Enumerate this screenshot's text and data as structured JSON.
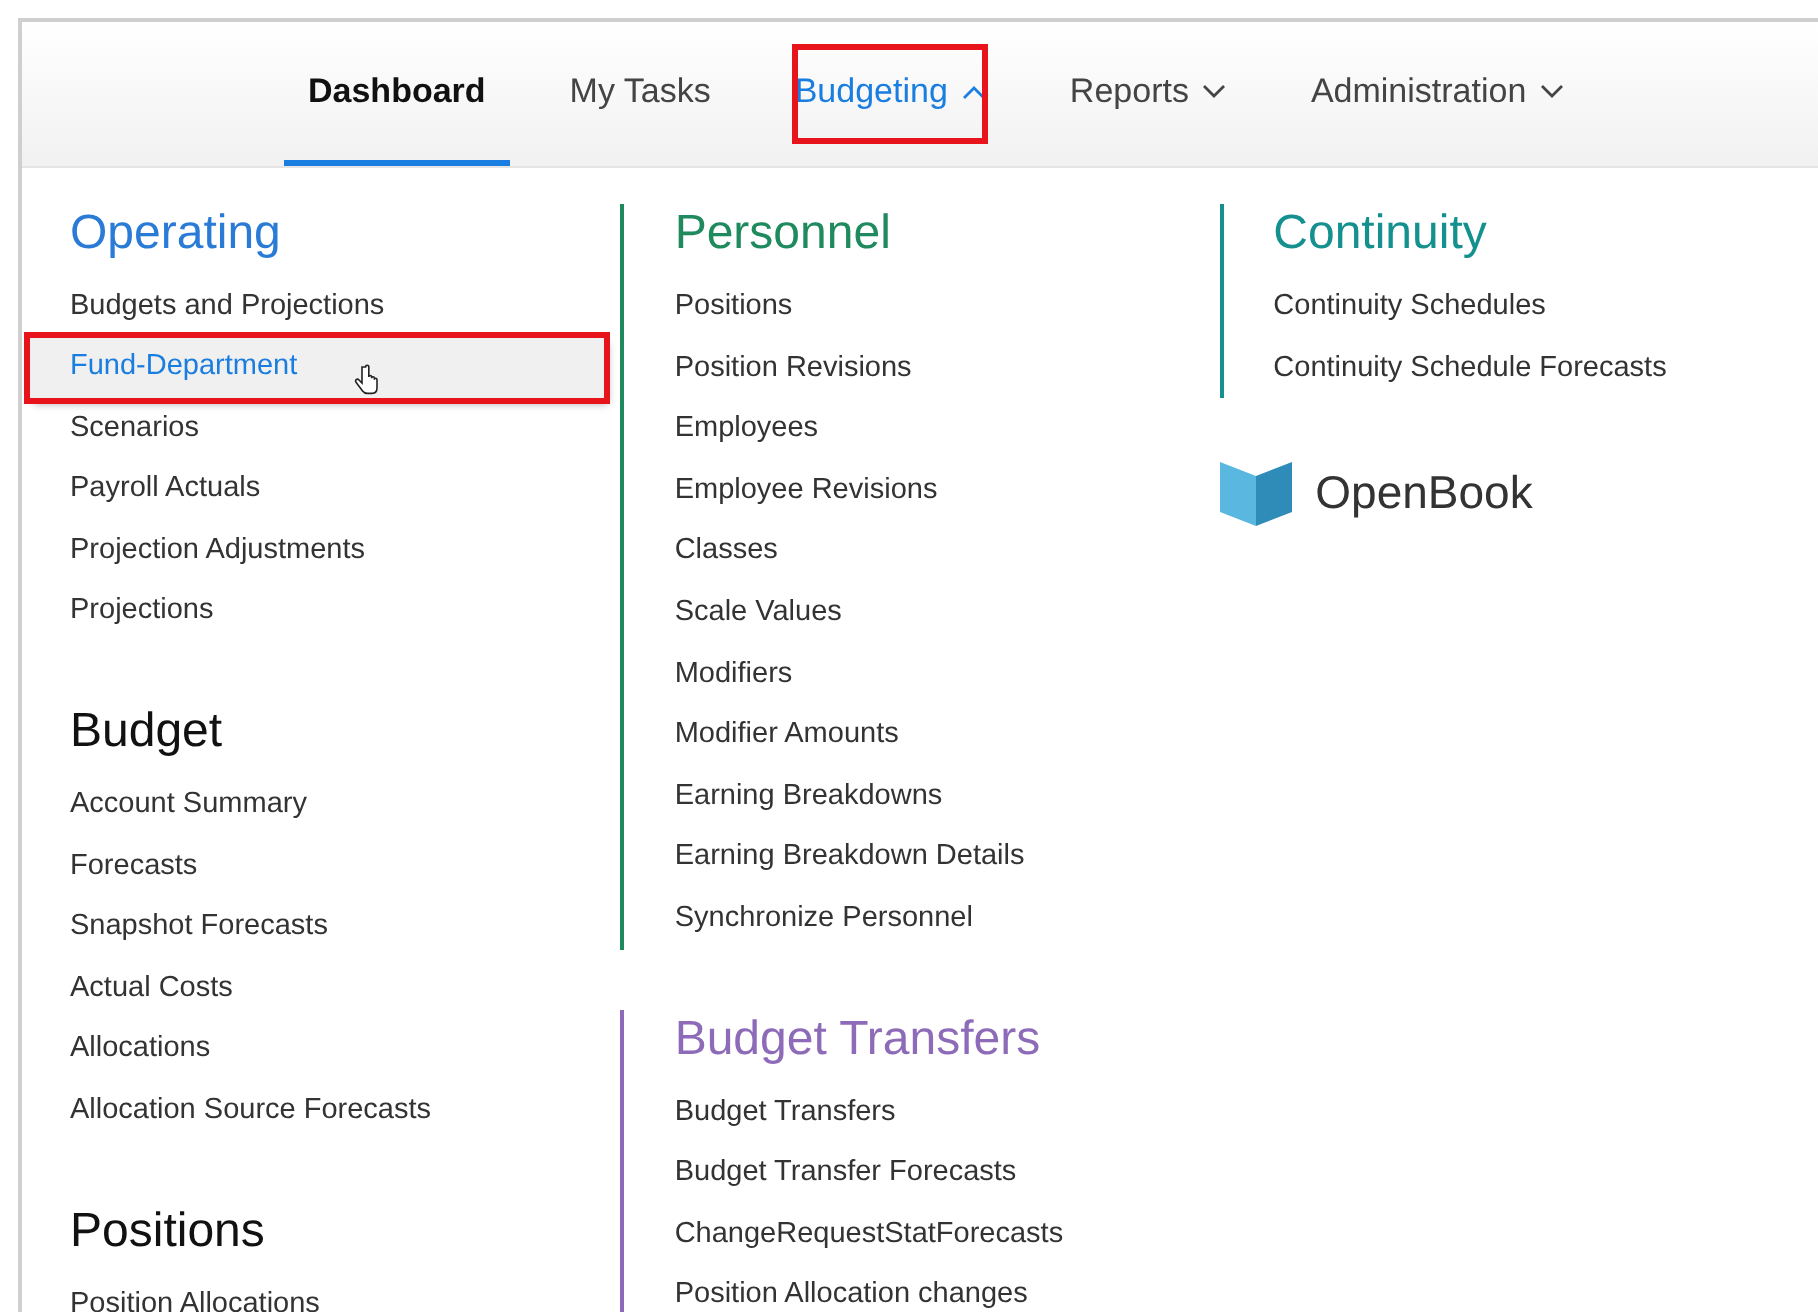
{
  "nav": {
    "tabs": [
      {
        "label": "Dashboard",
        "selected": true,
        "open": false,
        "highlighted": false,
        "has_menu": false
      },
      {
        "label": "My Tasks",
        "selected": false,
        "open": false,
        "highlighted": false,
        "has_menu": false
      },
      {
        "label": "Budgeting",
        "selected": false,
        "open": true,
        "highlighted": true,
        "has_menu": true
      },
      {
        "label": "Reports",
        "selected": false,
        "open": false,
        "highlighted": false,
        "has_menu": true
      },
      {
        "label": "Administration",
        "selected": false,
        "open": false,
        "highlighted": false,
        "has_menu": true
      }
    ]
  },
  "columns": [
    {
      "sections": [
        {
          "title": "Operating",
          "color": "#2a7bd6",
          "items": [
            {
              "label": "Budgets and Projections",
              "highlighted": false
            },
            {
              "label": "Fund-Department",
              "highlighted": true
            },
            {
              "label": "Scenarios",
              "highlighted": false
            },
            {
              "label": "Payroll Actuals",
              "highlighted": false
            },
            {
              "label": "Projection Adjustments",
              "highlighted": false
            },
            {
              "label": "Projections",
              "highlighted": false
            }
          ]
        },
        {
          "title": "Budget",
          "color": "#111111",
          "items": [
            {
              "label": "Account Summary",
              "highlighted": false
            },
            {
              "label": "Forecasts",
              "highlighted": false
            },
            {
              "label": "Snapshot Forecasts",
              "highlighted": false
            },
            {
              "label": "Actual Costs",
              "highlighted": false
            },
            {
              "label": "Allocations",
              "highlighted": false
            },
            {
              "label": "Allocation Source Forecasts",
              "highlighted": false
            }
          ]
        },
        {
          "title": "Positions",
          "color": "#111111",
          "items": [
            {
              "label": "Position Allocations",
              "highlighted": false
            }
          ]
        }
      ]
    },
    {
      "sections": [
        {
          "title": "Personnel",
          "color": "#1e8a5e",
          "items": [
            {
              "label": "Positions",
              "highlighted": false
            },
            {
              "label": "Position Revisions",
              "highlighted": false
            },
            {
              "label": "Employees",
              "highlighted": false
            },
            {
              "label": "Employee Revisions",
              "highlighted": false
            },
            {
              "label": "Classes",
              "highlighted": false
            },
            {
              "label": "Scale Values",
              "highlighted": false
            },
            {
              "label": "Modifiers",
              "highlighted": false
            },
            {
              "label": "Modifier Amounts",
              "highlighted": false
            },
            {
              "label": "Earning Breakdowns",
              "highlighted": false
            },
            {
              "label": "Earning Breakdown Details",
              "highlighted": false
            },
            {
              "label": "Synchronize Personnel",
              "highlighted": false
            }
          ]
        },
        {
          "title": "Budget Transfers",
          "color": "#8e6bb8",
          "items": [
            {
              "label": "Budget Transfers",
              "highlighted": false
            },
            {
              "label": "Budget Transfer Forecasts",
              "highlighted": false
            },
            {
              "label": "ChangeRequestStatForecasts",
              "highlighted": false
            },
            {
              "label": "Position Allocation changes",
              "highlighted": false
            }
          ]
        }
      ]
    },
    {
      "sections": [
        {
          "title": "Continuity",
          "color": "#14908f",
          "items": [
            {
              "label": "Continuity Schedules",
              "highlighted": false
            },
            {
              "label": "Continuity Schedule Forecasts",
              "highlighted": false
            }
          ]
        }
      ],
      "logo": {
        "text": "OpenBook"
      }
    }
  ]
}
